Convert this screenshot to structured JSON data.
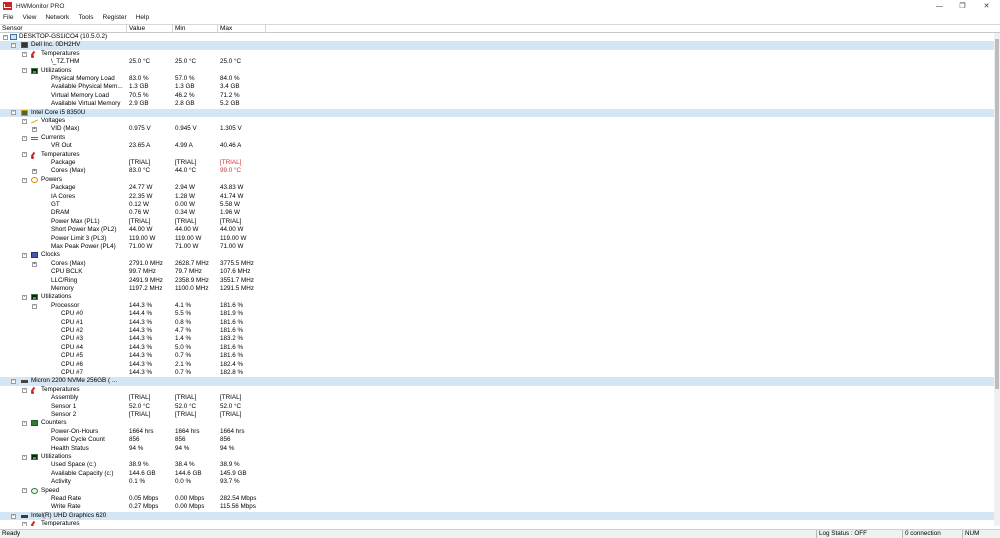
{
  "window": {
    "title": "HWMonitor PRO",
    "minimize": "—",
    "restore": "❐",
    "close": "✕"
  },
  "menu": [
    "File",
    "View",
    "Network",
    "Tools",
    "Register",
    "Help"
  ],
  "columns": {
    "sensor": "Sensor",
    "value": "Value",
    "min": "Min",
    "max": "Max"
  },
  "rows": [
    {
      "level": 0,
      "type": "root",
      "icon": "pc-icon",
      "toggle": "-",
      "label": "DESKTOP-GS1ICO4 (10.5.0.2)"
    },
    {
      "level": 1,
      "type": "device",
      "icon": "board-icon",
      "toggle": "-",
      "label": "Dell Inc. 0DH2HV"
    },
    {
      "level": 2,
      "type": "group",
      "icon": "thermometer-icon",
      "toggle": "-",
      "label": "Temperatures"
    },
    {
      "level": 3,
      "type": "sensor",
      "label": "\\_TZ.THM",
      "value": "25.0 °C",
      "min": "25.0 °C",
      "max": "25.0 °C"
    },
    {
      "level": 2,
      "type": "group",
      "icon": "utilization-icon",
      "toggle": "-",
      "label": "Utilizations"
    },
    {
      "level": 3,
      "type": "sensor",
      "label": "Physical Memory Load",
      "value": "83.0 %",
      "min": "57.0 %",
      "max": "84.0 %"
    },
    {
      "level": 3,
      "type": "sensor",
      "label": "Available Physical Mem...",
      "value": "1.3 GB",
      "min": "1.3 GB",
      "max": "3.4 GB"
    },
    {
      "level": 3,
      "type": "sensor",
      "label": "Virtual Memory Load",
      "value": "70.5 %",
      "min": "46.2 %",
      "max": "71.2 %"
    },
    {
      "level": 3,
      "type": "sensor",
      "label": "Available Virtual Memory",
      "value": "2.9 GB",
      "min": "2.8 GB",
      "max": "5.2 GB"
    },
    {
      "level": 1,
      "type": "device",
      "icon": "cpu-icon",
      "toggle": "-",
      "label": "Intel Core i5 8350U"
    },
    {
      "level": 2,
      "type": "group",
      "icon": "voltage-icon",
      "toggle": "-",
      "label": "Voltages"
    },
    {
      "level": 3,
      "type": "sensor",
      "toggle": "+",
      "label": "VID (Max)",
      "value": "0.975 V",
      "min": "0.945 V",
      "max": "1.305 V"
    },
    {
      "level": 2,
      "type": "group",
      "icon": "current-icon",
      "toggle": "-",
      "label": "Currents"
    },
    {
      "level": 3,
      "type": "sensor",
      "label": "VR Out",
      "value": "23.65 A",
      "min": "4.99 A",
      "max": "40.46 A"
    },
    {
      "level": 2,
      "type": "group",
      "icon": "thermometer-icon",
      "toggle": "-",
      "label": "Temperatures"
    },
    {
      "level": 3,
      "type": "sensor",
      "label": "Package",
      "value": "[TRIAL]",
      "min": "[TRIAL]",
      "max": "[TRIAL]",
      "hot": true
    },
    {
      "level": 3,
      "type": "sensor",
      "toggle": "+",
      "label": "Cores (Max)",
      "value": "83.0 °C",
      "min": "44.0 °C",
      "max": "99.0 °C",
      "hot": true
    },
    {
      "level": 2,
      "type": "group",
      "icon": "power-icon",
      "toggle": "-",
      "label": "Powers"
    },
    {
      "level": 3,
      "type": "sensor",
      "label": "Package",
      "value": "24.77 W",
      "min": "2.94 W",
      "max": "43.83 W"
    },
    {
      "level": 3,
      "type": "sensor",
      "label": "IA Cores",
      "value": "22.35 W",
      "min": "1.28 W",
      "max": "41.74 W"
    },
    {
      "level": 3,
      "type": "sensor",
      "label": "GT",
      "value": "0.12 W",
      "min": "0.00 W",
      "max": "5.58 W"
    },
    {
      "level": 3,
      "type": "sensor",
      "label": "DRAM",
      "value": "0.76 W",
      "min": "0.34 W",
      "max": "1.96 W"
    },
    {
      "level": 3,
      "type": "sensor",
      "label": "Power Max (PL1)",
      "value": "[TRIAL]",
      "min": "[TRIAL]",
      "max": "[TRIAL]"
    },
    {
      "level": 3,
      "type": "sensor",
      "label": "Short Power Max (PL2)",
      "value": "44.00 W",
      "min": "44.00 W",
      "max": "44.00 W"
    },
    {
      "level": 3,
      "type": "sensor",
      "label": "Power Limit 3 (PL3)",
      "value": "119.00 W",
      "min": "119.00 W",
      "max": "119.00 W"
    },
    {
      "level": 3,
      "type": "sensor",
      "label": "Max Peak Power (PL4)",
      "value": "71.00 W",
      "min": "71.00 W",
      "max": "71.00 W"
    },
    {
      "level": 2,
      "type": "group",
      "icon": "clock-icon",
      "toggle": "-",
      "label": "Clocks"
    },
    {
      "level": 3,
      "type": "sensor",
      "toggle": "+",
      "label": "Cores (Max)",
      "value": "2791.0 MHz",
      "min": "2628.7 MHz",
      "max": "3775.5 MHz"
    },
    {
      "level": 3,
      "type": "sensor",
      "label": "CPU BCLK",
      "value": "99.7 MHz",
      "min": "79.7 MHz",
      "max": "107.6 MHz"
    },
    {
      "level": 3,
      "type": "sensor",
      "label": "LLC/Ring",
      "value": "2491.9 MHz",
      "min": "2358.9 MHz",
      "max": "3551.7 MHz"
    },
    {
      "level": 3,
      "type": "sensor",
      "label": "Memory",
      "value": "1197.2 MHz",
      "min": "1100.0 MHz",
      "max": "1291.5 MHz"
    },
    {
      "level": 2,
      "type": "group",
      "icon": "utilization-icon",
      "toggle": "-",
      "label": "Utilizations"
    },
    {
      "level": 3,
      "type": "sensor",
      "toggle": "-",
      "label": "Processor",
      "value": "144.3 %",
      "min": "4.1 %",
      "max": "181.6 %"
    },
    {
      "level": 4,
      "type": "sensor",
      "label": "CPU #0",
      "value": "144.4 %",
      "min": "5.5 %",
      "max": "181.9 %"
    },
    {
      "level": 4,
      "type": "sensor",
      "label": "CPU #1",
      "value": "144.3 %",
      "min": "0.8 %",
      "max": "181.6 %"
    },
    {
      "level": 4,
      "type": "sensor",
      "label": "CPU #2",
      "value": "144.3 %",
      "min": "4.7 %",
      "max": "181.6 %"
    },
    {
      "level": 4,
      "type": "sensor",
      "label": "CPU #3",
      "value": "144.3 %",
      "min": "1.4 %",
      "max": "183.2 %"
    },
    {
      "level": 4,
      "type": "sensor",
      "label": "CPU #4",
      "value": "144.3 %",
      "min": "5.0 %",
      "max": "181.6 %"
    },
    {
      "level": 4,
      "type": "sensor",
      "label": "CPU #5",
      "value": "144.3 %",
      "min": "0.7 %",
      "max": "181.6 %"
    },
    {
      "level": 4,
      "type": "sensor",
      "label": "CPU #6",
      "value": "144.3 %",
      "min": "2.1 %",
      "max": "182.4 %"
    },
    {
      "level": 4,
      "type": "sensor",
      "label": "CPU #7",
      "value": "144.3 %",
      "min": "0.7 %",
      "max": "182.8 %"
    },
    {
      "level": 1,
      "type": "device",
      "icon": "disk-icon",
      "toggle": "-",
      "label": "Micron 2200 NVMe 256GB (      ..."
    },
    {
      "level": 2,
      "type": "group",
      "icon": "thermometer-icon",
      "toggle": "-",
      "label": "Temperatures"
    },
    {
      "level": 3,
      "type": "sensor",
      "label": "Assembly",
      "value": "[TRIAL]",
      "min": "[TRIAL]",
      "max": "[TRIAL]"
    },
    {
      "level": 3,
      "type": "sensor",
      "label": "Sensor 1",
      "value": "52.0 °C",
      "min": "52.0 °C",
      "max": "52.0 °C"
    },
    {
      "level": 3,
      "type": "sensor",
      "label": "Sensor 2",
      "value": "[TRIAL]",
      "min": "[TRIAL]",
      "max": "[TRIAL]"
    },
    {
      "level": 2,
      "type": "group",
      "icon": "counter-icon",
      "toggle": "-",
      "label": "Counters"
    },
    {
      "level": 3,
      "type": "sensor",
      "label": "Power-On-Hours",
      "value": "1664 hrs",
      "min": "1664 hrs",
      "max": "1664 hrs"
    },
    {
      "level": 3,
      "type": "sensor",
      "label": "Power Cycle Count",
      "value": "856",
      "min": "856",
      "max": "856"
    },
    {
      "level": 3,
      "type": "sensor",
      "label": "Health Status",
      "value": "94 %",
      "min": "94 %",
      "max": "94 %"
    },
    {
      "level": 2,
      "type": "group",
      "icon": "utilization-icon",
      "toggle": "-",
      "label": "Utilizations"
    },
    {
      "level": 3,
      "type": "sensor",
      "label": "Used Space (c:)",
      "value": "38.9 %",
      "min": "38.4 %",
      "max": "38.9 %"
    },
    {
      "level": 3,
      "type": "sensor",
      "label": "Available Capacity (c:)",
      "value": "144.6 GB",
      "min": "144.6 GB",
      "max": "145.9 GB"
    },
    {
      "level": 3,
      "type": "sensor",
      "label": "Activity",
      "value": "0.1 %",
      "min": "0.0 %",
      "max": "93.7 %"
    },
    {
      "level": 2,
      "type": "group",
      "icon": "speed-icon",
      "toggle": "-",
      "label": "Speed"
    },
    {
      "level": 3,
      "type": "sensor",
      "label": "Read Rate",
      "value": "0.05 Mbps",
      "min": "0.00 Mbps",
      "max": "282.54 Mbps"
    },
    {
      "level": 3,
      "type": "sensor",
      "label": "Write Rate",
      "value": "0.27 Mbps",
      "min": "0.00 Mbps",
      "max": "115.56 Mbps"
    },
    {
      "level": 1,
      "type": "device",
      "icon": "gpu-icon",
      "toggle": "-",
      "label": "Intel(R) UHD Graphics 620"
    },
    {
      "level": 2,
      "type": "group",
      "icon": "thermometer-icon",
      "toggle": "-",
      "label": "Temperatures"
    }
  ],
  "status": {
    "ready": "Ready",
    "log_status": "Log Status : OFF",
    "connections": "0 connection",
    "num": "NUM"
  }
}
